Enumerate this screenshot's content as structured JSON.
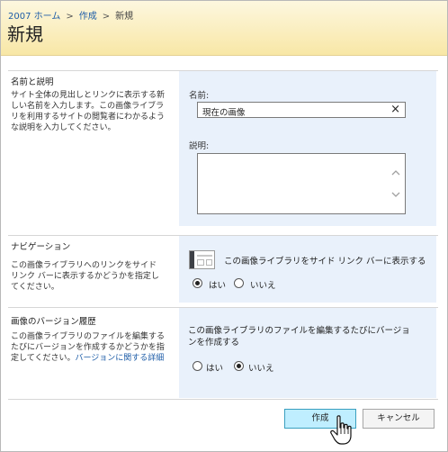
{
  "breadcrumb": {
    "home": "2007 ホーム",
    "sep1": ">",
    "create": "作成",
    "sep2": ">",
    "current": "新規"
  },
  "page_title": "新規",
  "name_section": {
    "title": "名前と説明",
    "description": "サイト全体の見出しとリンクに表示する新しい名前を入力します。この画像ライブラリを利用するサイトの閲覧者にわかるような説明を入力してください。",
    "name_label": "名前:",
    "name_value": "現在の画像",
    "clear_icon": "×",
    "desc_label": "説明:"
  },
  "navigation_section": {
    "title": "ナビゲーション",
    "description": "この画像ライブラリへのリンクをサイド リンク バーに表示するかどうかを指定してください。",
    "option_text": "この画像ライブラリをサイド リンク バーに表示する",
    "yes_label": "はい",
    "no_label": "いいえ",
    "selected": "yes"
  },
  "version_section": {
    "title": "画像のバージョン履歴",
    "description": "この画像ライブラリのファイルを編集するたびにバージョンを作成するかどうかを指定してください。",
    "detail_link": "バージョンに関する詳細",
    "option_text": "この画像ライブラリのファイルを編集するたびにバージョンを作成する",
    "yes_label": "はい",
    "no_label": "いいえ",
    "selected": "no"
  },
  "buttons": {
    "create": "作成",
    "cancel": "キャンセル"
  },
  "colors": {
    "header_bg": "#f8e7a6",
    "panel_bg": "#e9f1fb",
    "link": "#1f5ea8",
    "primary_button": "#bfeeff"
  },
  "icons": {
    "clear": "close-icon",
    "scroll_up": "chevron-up-icon",
    "scroll_down": "chevron-down-icon",
    "nav": "side-link-bar-icon",
    "cursor": "hand-pointer-icon"
  }
}
